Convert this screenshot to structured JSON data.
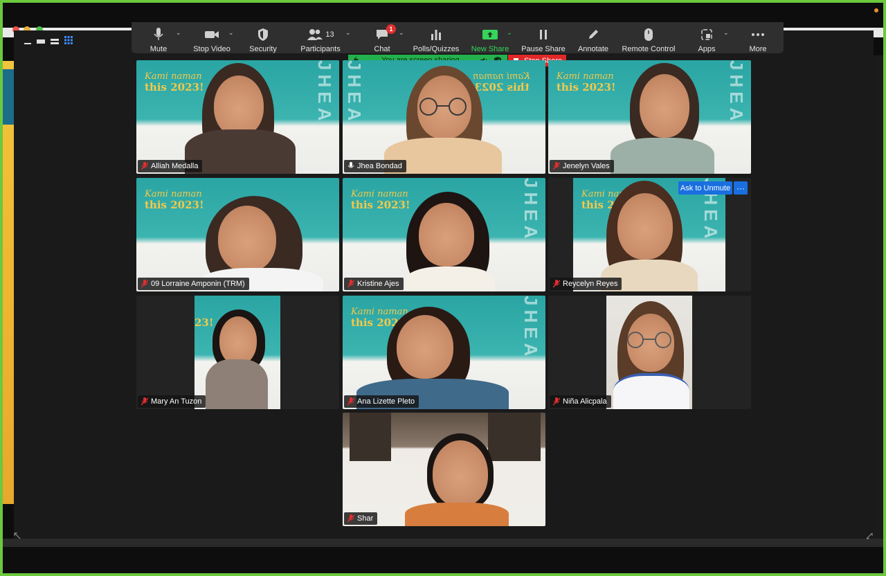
{
  "toolbar": {
    "mute": "Mute",
    "stop_video": "Stop Video",
    "security": "Security",
    "participants": "Participants",
    "participant_count": "13",
    "chat": "Chat",
    "chat_badge": "1",
    "polls": "Polls/Quizzes",
    "new_share": "New Share",
    "pause_share": "Pause Share",
    "annotate": "Annotate",
    "remote_control": "Remote Control",
    "apps": "Apps",
    "more": "More"
  },
  "share_banner": {
    "status": "You are screen sharing",
    "stop_label": "Stop Share",
    "banner_color": "#23b14d",
    "stop_color": "#e02828"
  },
  "tile_actions": {
    "ask_unmute": "Ask to Unmute",
    "more": "···"
  },
  "participants": [
    {
      "name": "Alliah Medalla"
    },
    {
      "name": "Jhea Bondad"
    },
    {
      "name": "Jenelyn Vales"
    },
    {
      "name": "09 Lorraine Amponin (TRM)"
    },
    {
      "name": "Kristine Ajes"
    },
    {
      "name": "Reycelyn Reyes"
    },
    {
      "name": "Mary An Tuzon"
    },
    {
      "name": "Ana Lizette Pleto"
    },
    {
      "name": "Niña Alicpala"
    },
    {
      "name": "Shar"
    }
  ],
  "colors": {
    "frame": "#6cc83c",
    "accent_green": "#36d65a",
    "accent_blue": "#1a6fe0",
    "muted_red": "#e02f2f"
  }
}
